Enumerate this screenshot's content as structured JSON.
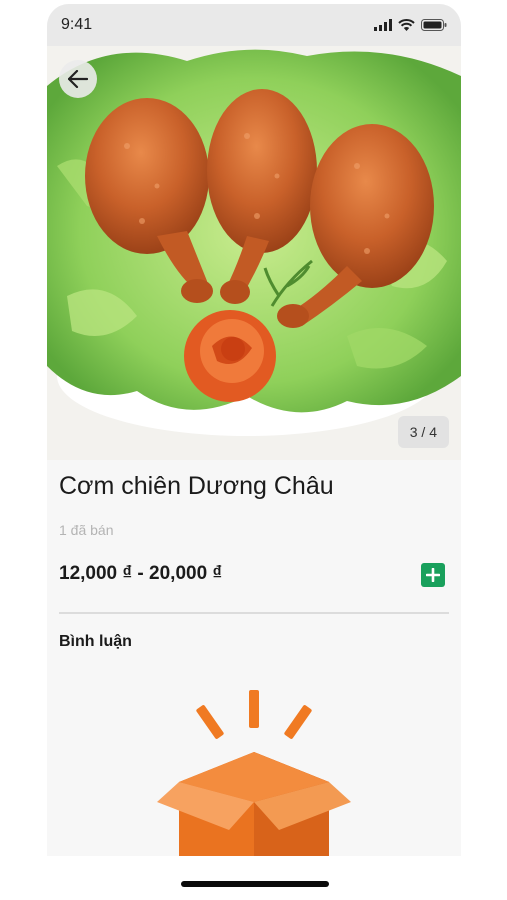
{
  "status_bar": {
    "time": "9:41"
  },
  "gallery": {
    "counter": "3 / 4"
  },
  "product": {
    "name": "Cơm chiên Dương Châu",
    "sold": "1 đã bán",
    "price_range": "12,000 ₫ - 20,000 ₫"
  },
  "comments": {
    "heading": "Bình luận"
  },
  "colors": {
    "accent_green": "#19a05c",
    "box_orange": "#f07a22",
    "text_dark": "#1b1b1b",
    "text_muted": "#b4b4b4"
  },
  "icons": {
    "back": "arrow-left-icon",
    "add": "plus-icon",
    "empty": "open-box-icon",
    "signal": "signal-icon",
    "wifi": "wifi-icon",
    "battery": "battery-icon"
  }
}
